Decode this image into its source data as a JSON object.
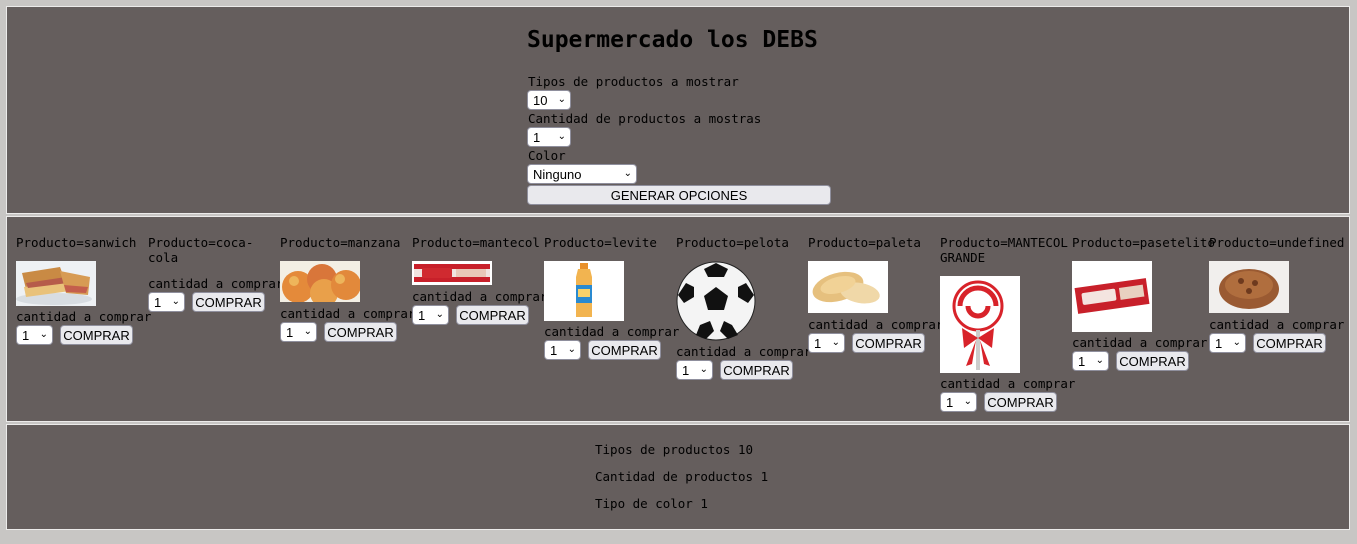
{
  "header": {
    "title": "Supermercado los DEBS",
    "types_label": "Tipos de productos a mostrar",
    "types_value": "10",
    "qty_label": "Cantidad de productos a mostras",
    "qty_value": "1",
    "color_label": "Color",
    "color_value": "Ninguno",
    "generate_label": "GENERAR OPCIONES"
  },
  "products": [
    {
      "name": "Producto=sanwich",
      "qty_label": "cantidad a comprar",
      "qty": "1",
      "buy": "COMPRAR"
    },
    {
      "name": "Producto=coca-cola",
      "qty_label": "cantidad a comprar",
      "qty": "1",
      "buy": "COMPRAR"
    },
    {
      "name": "Producto=manzana",
      "qty_label": "cantidad a comprar",
      "qty": "1",
      "buy": "COMPRAR"
    },
    {
      "name": "Producto=mantecol",
      "qty_label": "cantidad a comprar",
      "qty": "1",
      "buy": "COMPRAR"
    },
    {
      "name": "Producto=levite",
      "qty_label": "cantidad a comprar",
      "qty": "1",
      "buy": "COMPRAR"
    },
    {
      "name": "Producto=pelota",
      "qty_label": "cantidad a comprar",
      "qty": "1",
      "buy": "COMPRAR"
    },
    {
      "name": "Producto=paleta",
      "qty_label": "cantidad a comprar",
      "qty": "1",
      "buy": "COMPRAR"
    },
    {
      "name": "Producto=MANTECOL GRANDE",
      "qty_label": "cantidad a comprar",
      "qty": "1",
      "buy": "COMPRAR"
    },
    {
      "name": "Producto=pasetelito",
      "qty_label": "cantidad a comprar",
      "qty": "1",
      "buy": "COMPRAR"
    },
    {
      "name": "Producto=undefined",
      "qty_label": "cantidad a comprar",
      "qty": "1",
      "buy": "COMPRAR"
    }
  ],
  "summary": {
    "types": "Tipos de productos 10",
    "qty": "Cantidad de productos 1",
    "color": "Tipo de color 1"
  },
  "icons": {
    "select_arrow": "chevron-down-icon"
  },
  "colors": {
    "panel_bg": "#655e5d",
    "page_bg": "#c8c6c4"
  }
}
